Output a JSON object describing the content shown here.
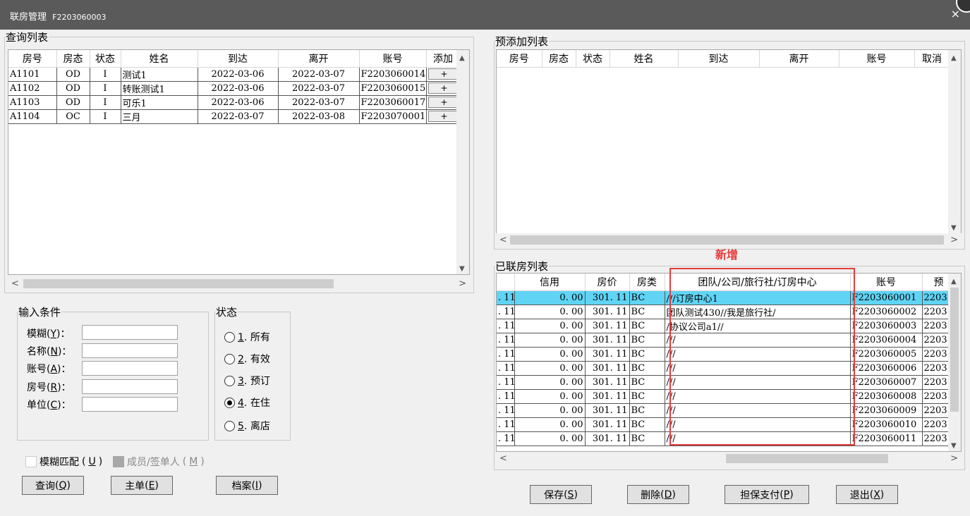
{
  "window": {
    "title": "联房管理",
    "code": "F2203060003",
    "close": "×"
  },
  "query": {
    "legend": "查询列表",
    "columns": [
      "房号",
      "房态",
      "状态",
      "姓名",
      "到达",
      "离开",
      "账号",
      "添加"
    ],
    "rows": [
      {
        "room": "A1101",
        "rstate": "OD",
        "status": "I",
        "name": "测试1",
        "arrive": "2022-03-06",
        "depart": "2022-03-07",
        "account": "F2203060014",
        "add": "+"
      },
      {
        "room": "A1102",
        "rstate": "OD",
        "status": "I",
        "name": "转账测试1",
        "arrive": "2022-03-06",
        "depart": "2022-03-07",
        "account": "F2203060015",
        "add": "+"
      },
      {
        "room": "A1103",
        "rstate": "OD",
        "status": "I",
        "name": "可乐1",
        "arrive": "2022-03-06",
        "depart": "2022-03-07",
        "account": "F2203060017",
        "add": "+"
      },
      {
        "room": "A1104",
        "rstate": "OC",
        "status": "I",
        "name": "三月",
        "arrive": "2022-03-07",
        "depart": "2022-03-08",
        "account": "F2203070001",
        "add": "+"
      }
    ]
  },
  "pre": {
    "legend": "预添加列表",
    "columns": [
      "房号",
      "房态",
      "状态",
      "姓名",
      "到达",
      "离开",
      "账号",
      "取消"
    ]
  },
  "linked": {
    "legend": "已联房列表",
    "annotation": "新增",
    "columns": [
      "",
      "信用",
      "房价",
      "房类",
      "团队/公司/旅行社/订房中心",
      "账号",
      "预"
    ],
    "rows": [
      {
        "c0": ". 11",
        "credit": "0. 00",
        "price": "301. 11",
        "type": "BC",
        "group": "///订房中心1",
        "account": "F2203060001",
        "extra": "2203"
      },
      {
        "c0": ". 11",
        "credit": "0. 00",
        "price": "301. 11",
        "type": "BC",
        "group": "团队测试430//我是旅行社/",
        "account": "F2203060002",
        "extra": "2203"
      },
      {
        "c0": ". 11",
        "credit": "0. 00",
        "price": "301. 11",
        "type": "BC",
        "group": "/协议公司a1//",
        "account": "F2203060003",
        "extra": "2203"
      },
      {
        "c0": ". 11",
        "credit": "0. 00",
        "price": "301. 11",
        "type": "BC",
        "group": "///",
        "account": "F2203060004",
        "extra": "2203"
      },
      {
        "c0": ". 11",
        "credit": "0. 00",
        "price": "301. 11",
        "type": "BC",
        "group": "///",
        "account": "F2203060005",
        "extra": "2203"
      },
      {
        "c0": ". 11",
        "credit": "0. 00",
        "price": "301. 11",
        "type": "BC",
        "group": "///",
        "account": "F2203060006",
        "extra": "2203"
      },
      {
        "c0": ". 11",
        "credit": "0. 00",
        "price": "301. 11",
        "type": "BC",
        "group": "///",
        "account": "F2203060007",
        "extra": "2203"
      },
      {
        "c0": ". 11",
        "credit": "0. 00",
        "price": "301. 11",
        "type": "BC",
        "group": "///",
        "account": "F2203060008",
        "extra": "2203"
      },
      {
        "c0": ". 11",
        "credit": "0. 00",
        "price": "301. 11",
        "type": "BC",
        "group": "///",
        "account": "F2203060009",
        "extra": "2203"
      },
      {
        "c0": ". 11",
        "credit": "0. 00",
        "price": "301. 11",
        "type": "BC",
        "group": "///",
        "account": "F2203060010",
        "extra": "2203"
      },
      {
        "c0": ". 11",
        "credit": "0. 00",
        "price": "301. 11",
        "type": "BC",
        "group": "///",
        "account": "F2203060011",
        "extra": "2203"
      }
    ]
  },
  "conditions": {
    "legend": "输入条件",
    "fuzzy": {
      "label": "模糊",
      "key": "Y",
      "suffix": ")："
    },
    "name": {
      "label": "名称",
      "key": "N",
      "suffix": ")："
    },
    "account": {
      "label": "账号",
      "key": "A",
      "suffix": ")："
    },
    "room": {
      "label": "房号",
      "key": "R",
      "suffix": ")："
    },
    "unit": {
      "label": "单位",
      "key": "C",
      "suffix": ")："
    }
  },
  "status": {
    "legend": "状态",
    "options": [
      {
        "key": "1",
        "label": ". 所有",
        "checked": false
      },
      {
        "key": "2",
        "label": ". 有效",
        "checked": false
      },
      {
        "key": "3",
        "label": ". 预订",
        "checked": false
      },
      {
        "key": "4",
        "label": ". 在住",
        "checked": true
      },
      {
        "key": "5",
        "label": ". 离店",
        "checked": false
      }
    ]
  },
  "checks": {
    "fuzzy_match": {
      "label": "模糊匹配",
      "key": "U"
    },
    "member": {
      "label": "成员/签单人",
      "key": "M"
    }
  },
  "buttons": {
    "query": {
      "label": "查询",
      "key": "Q"
    },
    "master": {
      "label": "主单",
      "key": "E"
    },
    "archive": {
      "label": "档案",
      "key": "I"
    },
    "save": {
      "label": "保存",
      "key": "S"
    },
    "delete": {
      "label": "删除",
      "key": "D"
    },
    "guarantee": {
      "label": "担保支付",
      "key": "P"
    },
    "exit": {
      "label": "退出",
      "key": "X"
    }
  },
  "scroll": {
    "up": "▲",
    "down": "▼",
    "left": "<",
    "right": ">"
  },
  "colors": {
    "titlebar": "#5a5a5a",
    "selected_row": "#5fd4f5",
    "annotation": "#e63b3b"
  }
}
